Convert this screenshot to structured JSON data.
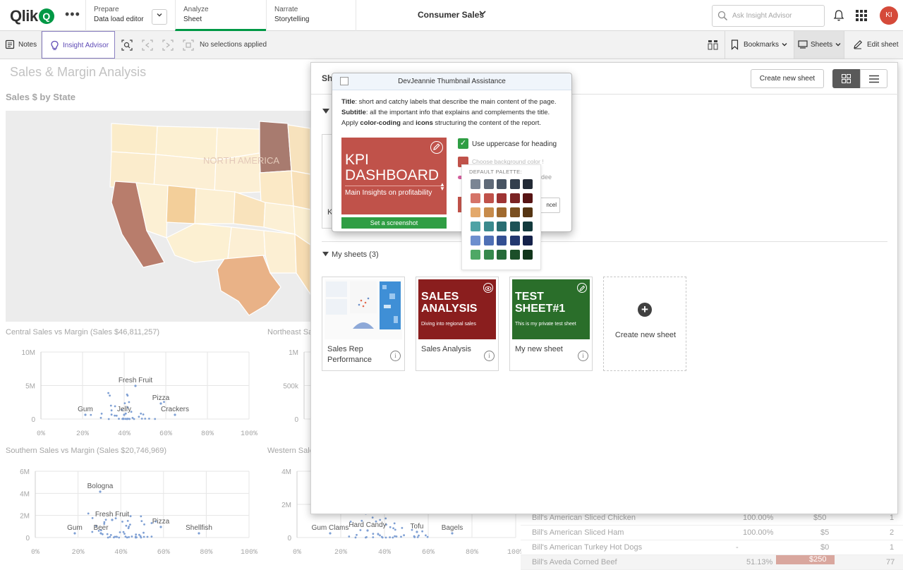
{
  "topbar": {
    "logo_text": "Qlik",
    "logo_mark": "Q",
    "more_label": "•••",
    "nav": [
      {
        "line1": "Prepare",
        "line2": "Data load editor"
      },
      {
        "line1": "Analyze",
        "line2": "Sheet"
      },
      {
        "line1": "Narrate",
        "line2": "Storytelling"
      }
    ],
    "app_title": "Consumer Sales",
    "search_placeholder": "Ask Insight Advisor",
    "avatar_initials": "KI",
    "accent_color": "#009845"
  },
  "toolbar": {
    "notes_label": "Notes",
    "insight_label": "Insight Advisor",
    "selections_text": "No selections applied",
    "bookmarks_label": "Bookmarks",
    "sheets_label": "Sheets",
    "edit_label": "Edit sheet"
  },
  "sheet": {
    "title": "Sales & Margin Analysis",
    "map_title": "Sales $ by State",
    "map_watermark": "NORTH AMERICA",
    "charts": [
      {
        "title": "Central Sales vs Margin (Sales $46,811,257)",
        "y_ticks": [
          "10M",
          "5M",
          "0"
        ],
        "x_ticks": [
          "0%",
          "20%",
          "40%",
          "60%",
          "80%",
          "100%"
        ],
        "labels": [
          "Fresh Fruit",
          "Pizza",
          "Gum",
          "Jelly",
          "Crackers"
        ]
      },
      {
        "title": "Northeast Sa",
        "y_ticks": [
          "1M",
          "500k",
          "0"
        ],
        "x_ticks": [],
        "labels": []
      },
      {
        "title": "Southern Sales vs Margin (Sales $20,746,969)",
        "y_ticks": [
          "6M",
          "4M",
          "2M",
          "0"
        ],
        "x_ticks": [
          "0%",
          "20%",
          "40%",
          "60%",
          "80%",
          "100%"
        ],
        "labels": [
          "Bologna",
          "Fresh Fruit",
          "Pizza",
          "Gum",
          "Beer",
          "Shellfish"
        ]
      },
      {
        "title": "Western Sale",
        "y_ticks": [
          "4M",
          "2M",
          "0"
        ],
        "x_ticks": [
          "0%",
          "20%",
          "40%",
          "60%",
          "80%",
          "100%"
        ],
        "labels": [
          "Gum Clams",
          "Hard Candy",
          "Tofu",
          "Bagels"
        ]
      }
    ],
    "table_rows": [
      {
        "name": "Bill's American Sliced Chicken",
        "pct": "100.00%",
        "amt": "$50",
        "n": "1"
      },
      {
        "name": "Bill's American Sliced Ham",
        "pct": "100.00%",
        "amt": "$5",
        "n": "2"
      },
      {
        "name": "Bill's American Turkey Hot Dogs",
        "pct": "-",
        "amt": "$0",
        "n": "1"
      },
      {
        "name": "Bill's Aveda Corned Beef",
        "pct": "51.13%",
        "amt": "$250",
        "n": "77"
      }
    ]
  },
  "sheets_panel": {
    "header_label": "She",
    "create_button": "Create new sheet",
    "my_sheets_header": "My sheets (3)",
    "public_first_card_text": "K",
    "cards": [
      {
        "name": "Sales Rep Performance",
        "thumb_title": "",
        "thumb_sub": "",
        "thumb_color": "#ffffff"
      },
      {
        "name": "Sales Analysis",
        "thumb_title": "SALES ANALYSIS",
        "thumb_sub": "Diving into regional sales",
        "thumb_color": "#8a1e1e"
      },
      {
        "name": "My new sheet",
        "thumb_title": "TEST SHEET#1",
        "thumb_sub": "This is my private test sheet",
        "thumb_color": "#2a6e2a"
      }
    ],
    "create_card_label": "Create new sheet",
    "info_glyph": "i"
  },
  "devjeannie": {
    "title": "DevJeannie Thumbnail Assistance",
    "desc_title_key": "Title",
    "desc_title_val": ": short and catchy labels that describe the main content of the page.",
    "desc_sub_key": "Subtitle",
    "desc_sub_val": ": all the important info that explains and complements the title.",
    "desc_apply_a": "Apply ",
    "desc_apply_b": "color-coding",
    "desc_apply_c": " and ",
    "desc_apply_d": "icons",
    "desc_apply_e": " structuring the content of the report.",
    "kpi_title": "KPI DASHBOARD",
    "kpi_subtitle": "Main Insights on profitability",
    "kpi_color": "#c0524a",
    "screenshot_button": "Set a screenshot",
    "uppercase_label": "Use uppercase for heading",
    "uppercase_checked": true,
    "bg_color_label": "Choose background color !",
    "side_fragment": "Sidee",
    "cancel_fragment": "ncel",
    "palette_label": "DEFAULT PALETTE:",
    "palette": [
      [
        "#7b8594",
        "#5f6a78",
        "#485463",
        "#343f4d",
        "#222a35"
      ],
      [
        "#d57468",
        "#c0524a",
        "#9e3434",
        "#7a2323",
        "#571414"
      ],
      [
        "#e3a96b",
        "#c78b4b",
        "#a06a2f",
        "#7a4f20",
        "#553513"
      ],
      [
        "#4fa3a5",
        "#3a8a8d",
        "#2a6e72",
        "#1d5256",
        "#12393c"
      ],
      [
        "#6d8fce",
        "#4f70b5",
        "#334f92",
        "#22376f",
        "#15224a"
      ],
      [
        "#4fa866",
        "#36894d",
        "#276b3a",
        "#1b4f29",
        "#11351b"
      ]
    ]
  }
}
